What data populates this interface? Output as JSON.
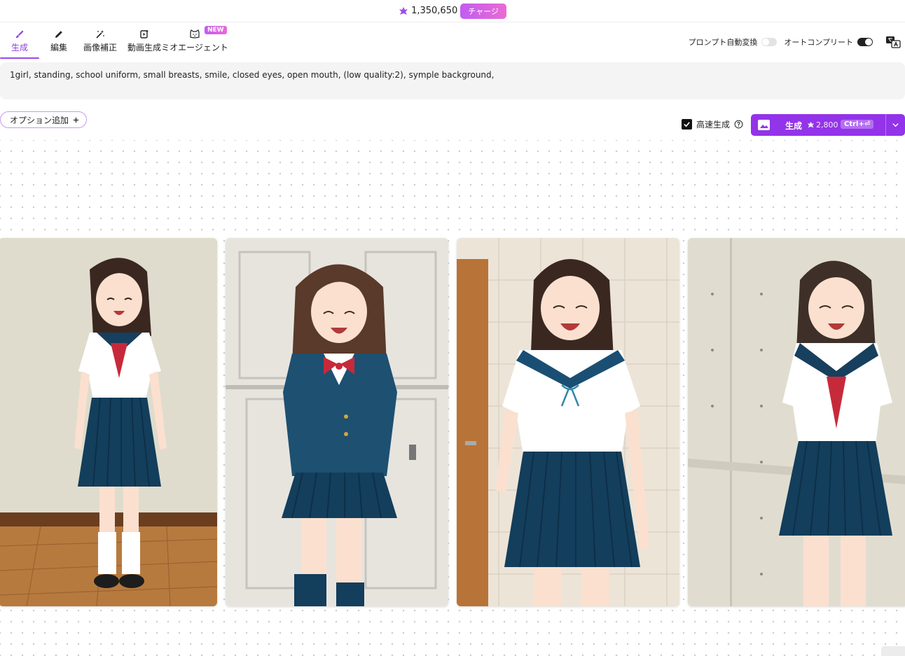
{
  "credit": {
    "amount": "1,350,650",
    "charge_label": "チャージ"
  },
  "nav": {
    "tabs": [
      {
        "label": "生成",
        "icon": "brush-icon",
        "active": true
      },
      {
        "label": "編集",
        "icon": "pencil-icon",
        "active": false
      },
      {
        "label": "画像補正",
        "icon": "magic-wand-icon",
        "active": false
      },
      {
        "label": "動画生成",
        "icon": "video-icon",
        "active": false
      },
      {
        "label": "ミオエージェント",
        "icon": "cat-icon",
        "active": false
      }
    ],
    "new_badge": "NEW",
    "toggle_prompt_convert": {
      "label": "プロンプト自動変換",
      "on": false
    },
    "toggle_autocomplete": {
      "label": "オートコンプリート",
      "on": true
    }
  },
  "prompt": {
    "text": "1girl, standing, school uniform, small breasts, smile, closed eyes, open mouth, (low quality:2), symple background,"
  },
  "options": {
    "add_label": "オプション追加"
  },
  "fast_generation": {
    "label": "高速生成",
    "checked": true
  },
  "generate": {
    "label": "生成",
    "cost": "2,800",
    "shortcut": "Ctrl+⏎"
  },
  "colors": {
    "accent": "#9333ea",
    "skirt": "#133e5c",
    "blazer": "#1d5071",
    "ribbon": "#c62a3a",
    "hair": "#3a2820"
  },
  "results": [
    {
      "name": "result-image-1",
      "uniform": "sailor-red-scarf",
      "background": "beige wall, wooden floor"
    },
    {
      "name": "result-image-2",
      "uniform": "blazer-red-bow",
      "background": "white paneled doors"
    },
    {
      "name": "result-image-3",
      "uniform": "sailor-blue-ribbon",
      "background": "tiled wall, wooden door"
    },
    {
      "name": "result-image-4",
      "uniform": "sailor-red-scarf",
      "background": "beige wall"
    }
  ]
}
